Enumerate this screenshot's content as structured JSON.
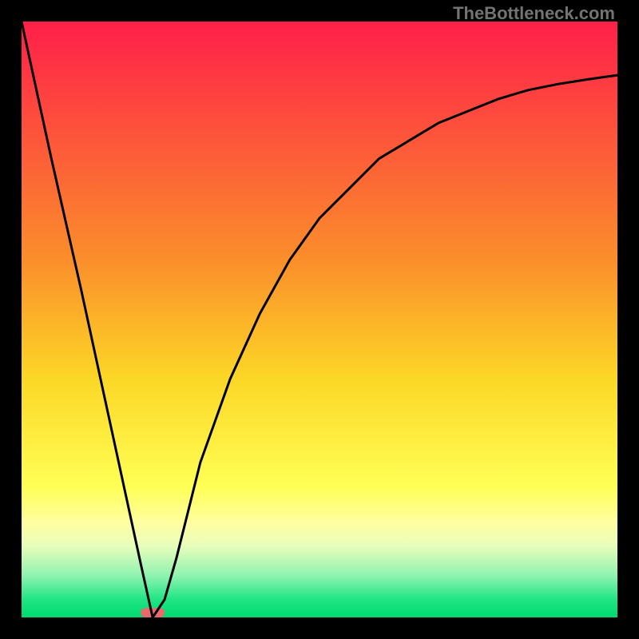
{
  "brand": "TheBottleneck.com",
  "chart_data": {
    "type": "line",
    "title": "",
    "xlabel": "",
    "ylabel": "",
    "xlim": [
      0,
      100
    ],
    "ylim": [
      0,
      100
    ],
    "series": [
      {
        "name": "bottleneck-curve",
        "x": [
          0,
          5,
          10,
          15,
          20,
          22,
          24,
          26,
          28,
          30,
          35,
          40,
          45,
          50,
          55,
          60,
          65,
          70,
          75,
          80,
          85,
          90,
          95,
          100
        ],
        "values": [
          100,
          77,
          55,
          32,
          9,
          0,
          3,
          10,
          18,
          26,
          40,
          51,
          60,
          67,
          72,
          77,
          80,
          83,
          85,
          87,
          88.5,
          89.5,
          90.3,
          91
        ]
      }
    ],
    "marker": {
      "x": 22,
      "color": "#E96A6B",
      "width_pct": 4,
      "height_pct": 1.6
    },
    "gradient_stops": [
      {
        "offset": 0,
        "color": "#FF1F49"
      },
      {
        "offset": 40,
        "color": "#FB8E2B"
      },
      {
        "offset": 60,
        "color": "#FCD726"
      },
      {
        "offset": 78,
        "color": "#FFFF55"
      },
      {
        "offset": 84,
        "color": "#FFFFA0"
      },
      {
        "offset": 88,
        "color": "#E8FDBB"
      },
      {
        "offset": 93,
        "color": "#8FF3B0"
      },
      {
        "offset": 97,
        "color": "#1FE584"
      },
      {
        "offset": 100,
        "color": "#00D96F"
      }
    ],
    "stroke": {
      "color": "#000000",
      "width": 3
    }
  }
}
